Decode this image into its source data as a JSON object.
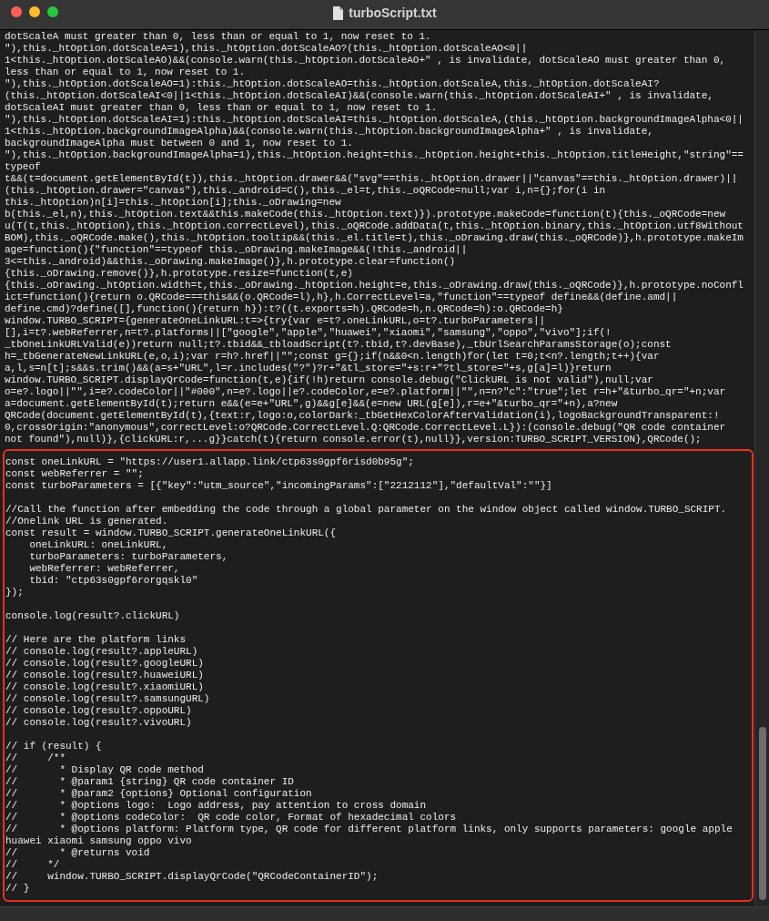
{
  "window": {
    "title": "turboScript.txt"
  },
  "code_lines": [
    "dotScaleA must greater than 0, less than or equal to 1, now reset to 1.",
    "\"),this._htOption.dotScaleA=1),this._htOption.dotScaleAO?(this._htOption.dotScaleAO<0||",
    "1<this._htOption.dotScaleAO)&&(console.warn(this._htOption.dotScaleAO+\" , is invalidate, dotScaleAO must greater than 0,",
    "less than or equal to 1, now reset to 1.",
    "\"),this._htOption.dotScaleAO=1):this._htOption.dotScaleAO=this._htOption.dotScaleA,this._htOption.dotScaleAI?",
    "(this._htOption.dotScaleAI<0||1<this._htOption.dotScaleAI)&&(console.warn(this._htOption.dotScaleAI+\" , is invalidate,",
    "dotScaleAI must greater than 0, less than or equal to 1, now reset to 1.",
    "\"),this._htOption.dotScaleAI=1):this._htOption.dotScaleAI=this._htOption.dotScaleA,(this._htOption.backgroundImageAlpha<0||",
    "1<this._htOption.backgroundImageAlpha)&&(console.warn(this._htOption.backgroundImageAlpha+\" , is invalidate,",
    "backgroundImageAlpha must between 0 and 1, now reset to 1.",
    "\"),this._htOption.backgroundImageAlpha=1),this._htOption.height=this._htOption.height+this._htOption.titleHeight,\"string\"==",
    "typeof",
    "t&&(t=document.getElementById(t)),this._htOption.drawer&&(\"svg\"==this._htOption.drawer||\"canvas\"==this._htOption.drawer)||",
    "(this._htOption.drawer=\"canvas\"),this._android=C(),this._el=t,this._oQRCode=null;var i,n={};for(i in",
    "this._htOption)n[i]=this._htOption[i];this._oDrawing=new",
    "b(this._el,n),this._htOption.text&&this.makeCode(this._htOption.text)}).prototype.makeCode=function(t){this._oQRCode=new",
    "u(T(t,this._htOption),this._htOption.correctLevel),this._oQRCode.addData(t,this._htOption.binary,this._htOption.utf8Without",
    "BOM),this._oQRCode.make(),this._htOption.tooltip&&(this._el.title=t),this._oDrawing.draw(this._oQRCode)},h.prototype.makeIm",
    "age=function(){\"function\"==typeof this._oDrawing.makeImage&&(!this._android||",
    "3<=this._android)&&this._oDrawing.makeImage()},h.prototype.clear=function()",
    "{this._oDrawing.remove()},h.prototype.resize=function(t,e)",
    "{this._oDrawing._htOption.width=t,this._oDrawing._htOption.height=e,this._oDrawing.draw(this._oQRCode)},h.prototype.noConfl",
    "ict=function(){return o.QRCode===this&&(o.QRCode=l),h},h.CorrectLevel=a,\"function\"==typeof define&&(define.amd||",
    "define.cmd)?define([],function(){return h}):t?((t.exports=h).QRCode=h,n.QRCode=h):o.QRCode=h}",
    "window.TURBO_SCRIPT={generateOneLinkURL:t=>{try{var e=t?.oneLinkURL,o=t?.turboParameters||",
    "[],i=t?.webReferrer,n=t?.platforms||[\"google\",\"apple\",\"huawei\",\"xiaomi\",\"samsung\",\"oppo\",\"vivo\"];if(!",
    "_tbOneLinkURLValid(e))return null;t?.tbid&&_tbloadScript(t?.tbid,t?.devBase),_tbUrlSearchParamsStorage(o);const",
    "h=_tbGenerateNewLinkURL(e,o,i);var r=h?.href||\"\";const g={};if(n&&0<n.length)for(let t=0;t<n?.length;t++){var",
    "a,l,s=n[t];s&&s.trim()&&(a=s+\"URL\",l=r.includes(\"?\")?r+\"&tl_store=\"+s:r+\"?tl_store=\"+s,g[a]=l)}return",
    "window.TURBO_SCRIPT.displayQrCode=function(t,e){if(!h)return console.debug(\"ClickURL is not valid\"),null;var",
    "o=e?.logo||\"\",i=e?.codeColor||\"#000\",n=e?.logo||e?.codeColor,e=e?.platform||\"\",n=n?\"c\":\"true\";let r=h+\"&turbo_qr=\"+n;var",
    "a=document.getElementById(t);return e&&(e=e+\"URL\",g)&&g[e]&&(e=new URL(g[e]),r=e+\"&turbo_qr=\"+n),a?new",
    "QRCode(document.getElementById(t),{text:r,logo:o,colorDark:_tbGetHexColorAfterValidation(i),logoBackgroundTransparent:!",
    "0,crossOrigin:\"anonymous\",correctLevel:o?QRCode.CorrectLevel.Q:QRCode.CorrectLevel.L}):(console.debug(\"QR code container",
    "not found\"),null)},{clickURL:r,...g}}catch(t){return console.error(t),null}},version:TURBO_SCRIPT_VERSION},QRCode();"
  ],
  "highlighted_blocks": [
    [
      "const oneLinkURL = \"https://user1.allapp.link/ctp63s0gpf6risd0b95g\";",
      "const webReferrer = \"\";",
      "const turboParameters = [{\"key\":\"utm_source\",\"incomingParams\":[\"2212112\"],\"defaultVal\":\"\"}]"
    ],
    [
      "//Call the function after embedding the code through a global parameter on the window object called window.TURBO_SCRIPT.",
      "//Onelink URL is generated.",
      "const result = window.TURBO_SCRIPT.generateOneLinkURL({",
      "    oneLinkURL: oneLinkURL,",
      "    turboParameters: turboParameters,",
      "    webReferrer: webReferrer,",
      "    tbid: \"ctp63s0gpf6rorgqskl0\"",
      "});"
    ],
    [
      "console.log(result?.clickURL)"
    ],
    [
      "// Here are the platform links",
      "// console.log(result?.appleURL)",
      "// console.log(result?.googleURL)",
      "// console.log(result?.huaweiURL)",
      "// console.log(result?.xiaomiURL)",
      "// console.log(result?.samsungURL)",
      "// console.log(result?.oppoURL)",
      "// console.log(result?.vivoURL)"
    ],
    [
      "// if (result) {",
      "//     /**",
      "//       * Display QR code method",
      "//       * @param1 {string} QR code container ID",
      "//       * @param2 {options} Optional configuration",
      "//       * @options logo:  Logo address, pay attention to cross domain",
      "//       * @options codeColor:  QR code color, Format of hexadecimal colors",
      "//       * @options platform: Platform type, QR code for different platform links, only supports parameters: google apple",
      "huawei xiaomi samsung oppo vivo",
      "//       * @returns void",
      "//     */",
      "//     window.TURBO_SCRIPT.displayQrCode(\"QRCodeContainerID\");",
      "// }"
    ]
  ]
}
